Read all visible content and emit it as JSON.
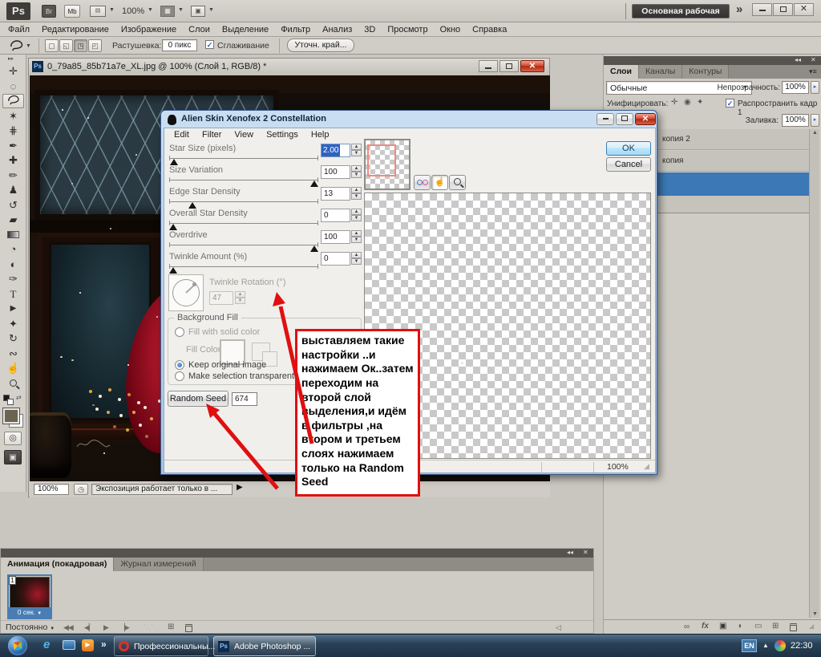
{
  "topbar": {
    "logo": "Ps",
    "bridge_label": "Br",
    "minibridge_label": "Mb",
    "zoom": "100%",
    "workspace": "Основная рабочая среда",
    "overflow": "»"
  },
  "menubar": {
    "items": [
      "Файл",
      "Редактирование",
      "Изображение",
      "Слои",
      "Выделение",
      "Фильтр",
      "Анализ",
      "3D",
      "Просмотр",
      "Окно",
      "Справка"
    ]
  },
  "optionsbar": {
    "feather_label": "Растушевка:",
    "feather_value": "0 пикс",
    "antialias_label": "Сглаживание",
    "refine_edge_label": "Уточн. край..."
  },
  "document": {
    "title": "0_79a85_85b71a7e_XL.jpg @ 100% (Слой 1, RGB/8) *",
    "zoom": "100%",
    "status_hint": "Экспозиция работает только в ..."
  },
  "dialog": {
    "title": "Alien Skin Xenofex 2 Constellation",
    "menu_items": [
      "Edit",
      "Filter",
      "View",
      "Settings",
      "Help"
    ],
    "sliders": [
      {
        "label": "Star Size (pixels)",
        "value": "2.00"
      },
      {
        "label": "Size Variation",
        "value": "100"
      },
      {
        "label": "Edge Star Density",
        "value": "13"
      },
      {
        "label": "Overall Star Density",
        "value": "0"
      },
      {
        "label": "Overdrive",
        "value": "100"
      },
      {
        "label": "Twinkle Amount (%)",
        "value": "0"
      }
    ],
    "twinkle_rotation_label": "Twinkle Rotation (°)",
    "twinkle_rotation_value": "47",
    "background_fill_title": "Background Fill",
    "fill_options": [
      {
        "label": "Fill with solid color"
      },
      {
        "label": "Keep original image"
      },
      {
        "label": "Make selection transparent"
      }
    ],
    "fill_color_label": "Fill Color",
    "random_seed_label": "Random Seed",
    "random_seed_value": "674",
    "ok_label": "OK",
    "cancel_label": "Cancel",
    "zoom": "100%"
  },
  "annotation": {
    "text": "выставляем такие настройки ..и нажимаем Ок..затем переходим на второй слой выделения,и идём в фильтры ,на втором и третьем слоях нажимаем только на Random Seed"
  },
  "layers_panel": {
    "tabs": [
      "Слои",
      "Каналы",
      "Контуры"
    ],
    "blend_mode": "Обычные",
    "opacity_label": "Непрозрачность:",
    "opacity_value": "100%",
    "unify_label": "Унифицировать:",
    "propagate_label": "Распространить кадр 1",
    "fill_label": "Заливка:",
    "fill_value": "100%",
    "fx_label": "fx",
    "layer_rows": [
      {
        "name": "копия 2"
      },
      {
        "name": "копия"
      },
      {
        "name": ""
      }
    ]
  },
  "animation_panel": {
    "tabs": [
      "Анимация (покадровая)",
      "Журнал измерений"
    ],
    "frame_number": "1",
    "frame_delay": "0 сек.",
    "loop_mode": "Постоянно"
  },
  "taskbar": {
    "tasks": [
      {
        "label": "Профессиональны..."
      },
      {
        "label": "Adobe Photoshop ..."
      }
    ],
    "tray_lang": "EN",
    "tray_time": "22:30"
  },
  "toolbox": {
    "tools": [
      {
        "name": "move-tool",
        "glyph": "✛"
      },
      {
        "name": "marquee-tool",
        "glyph": "◌"
      },
      {
        "name": "lasso-tool",
        "glyph": ""
      },
      {
        "name": "magic-wand-tool",
        "glyph": "✶"
      },
      {
        "name": "crop-tool",
        "glyph": "⋕"
      },
      {
        "name": "eyedropper-tool",
        "glyph": "✒"
      },
      {
        "name": "healing-brush-tool",
        "glyph": "✚"
      },
      {
        "name": "brush-tool",
        "glyph": "✏"
      },
      {
        "name": "clone-stamp-tool",
        "glyph": "♟"
      },
      {
        "name": "history-brush-tool",
        "glyph": "↺"
      },
      {
        "name": "eraser-tool",
        "glyph": "▰"
      },
      {
        "name": "gradient-tool",
        "glyph": ""
      },
      {
        "name": "blur-tool",
        "glyph": "◔"
      },
      {
        "name": "dodge-tool",
        "glyph": "◐"
      },
      {
        "name": "pen-tool",
        "glyph": "✑"
      },
      {
        "name": "type-tool",
        "glyph": "T"
      },
      {
        "name": "path-selection-tool",
        "glyph": "▶"
      },
      {
        "name": "shape-tool",
        "glyph": "✦"
      },
      {
        "name": "rotate-3d-tool",
        "glyph": "↻"
      },
      {
        "name": "orbit-3d-tool",
        "glyph": "∾"
      },
      {
        "name": "hand-tool",
        "glyph": "☝"
      },
      {
        "name": "zoom-tool",
        "glyph": ""
      }
    ]
  }
}
